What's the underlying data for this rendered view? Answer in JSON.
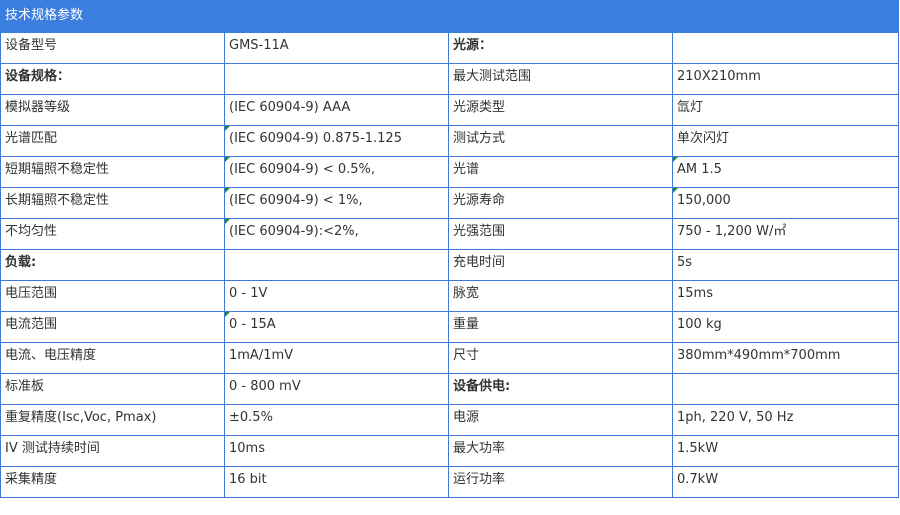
{
  "title": "技术规格参数",
  "rows": [
    {
      "c1": "设备型号",
      "c2": "GMS-11A",
      "c3": "光源：",
      "c4": ""
    },
    {
      "c1": "设备规格：",
      "c2": "",
      "c3": "最大测试范围",
      "c4": "210X210mm"
    },
    {
      "c1": "模拟器等级",
      "c2": "(IEC 60904-9) AAA",
      "c3": "光源类型",
      "c4": "氙灯"
    },
    {
      "c1": "光谱匹配",
      "c2": "(IEC 60904-9) 0.875-1.125",
      "c3": "测试方式",
      "c4": "单次闪灯"
    },
    {
      "c1": "短期辐照不稳定性",
      "c2": "(IEC 60904-9) < 0.5%,",
      "c3": "光谱",
      "c4": "AM 1.5"
    },
    {
      "c1": "长期辐照不稳定性",
      "c2": "(IEC 60904-9) < 1%,",
      "c3": "光源寿命",
      "c4": "150,000"
    },
    {
      "c1": "不均匀性",
      "c2": "(IEC 60904-9):<2%,",
      "c3": "光强范围",
      "c4": "750 - 1,200 W/㎡"
    },
    {
      "c1": "负载:",
      "c2": "",
      "c3": "充电时间",
      "c4": "5s"
    },
    {
      "c1": "电压范围",
      "c2": "0 - 1V",
      "c3": "脉宽",
      "c4": "15ms"
    },
    {
      "c1": "电流范围",
      "c2": "0 - 15A",
      "c3": "重量",
      "c4": "100 kg"
    },
    {
      "c1": "电流、电压精度",
      "c2": "1mA/1mV",
      "c3": "尺寸",
      "c4": "380mm*490mm*700mm"
    },
    {
      "c1": "标准板",
      "c2": "0 - 800 mV",
      "c3": "设备供电:",
      "c4": ""
    },
    {
      "c1": "重复精度(Isc,Voc, Pmax)",
      "c2": "±0.5%",
      "c3": "电源",
      "c4": "1ph, 220 V, 50 Hz"
    },
    {
      "c1": "IV 测试持续时间",
      "c2": "10ms",
      "c3": "最大功率",
      "c4": "1.5kW"
    },
    {
      "c1": "采集精度",
      "c2": "16 bit",
      "c3": "运行功率",
      "c4": "0.7kW"
    }
  ],
  "colors": {
    "header_bg": "#3b7ee0",
    "border": "#3b78d8",
    "corner_mark": "#1d8a3a"
  }
}
